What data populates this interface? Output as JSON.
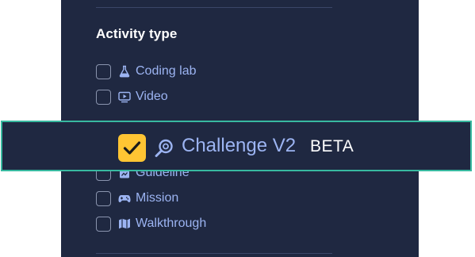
{
  "filter": {
    "title": "Activity type",
    "options": [
      {
        "label": "Coding lab",
        "icon": "flask-icon",
        "checked": false
      },
      {
        "label": "Video",
        "icon": "video-icon",
        "checked": false
      },
      {
        "label": "Challenge V2",
        "icon": "magnifier-icon",
        "checked": true,
        "badge": "BETA"
      },
      {
        "label": "Guideline",
        "icon": "guideline-icon",
        "checked": false
      },
      {
        "label": "Mission",
        "icon": "gamepad-icon",
        "checked": false
      },
      {
        "label": "Walkthrough",
        "icon": "map-icon",
        "checked": false
      }
    ]
  },
  "colors": {
    "panel_bg": "#1f2841",
    "label": "#9cb4f2",
    "checkbox_checked": "#ffc533",
    "highlight_border": "#38b9a0"
  }
}
